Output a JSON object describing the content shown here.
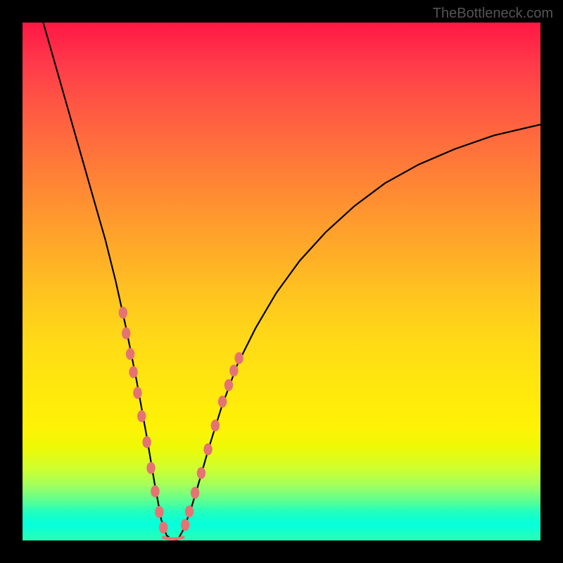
{
  "watermark_text": "TheBottleneck.com",
  "chart_data": {
    "type": "line",
    "title": "",
    "xlabel": "",
    "ylabel": "",
    "description": "V-shaped bottleneck curve over a rainbow gradient (red at top = high bottleneck, green at bottom = no bottleneck). The notch dips to zero around x≈0.29 indicating the optimal pairing.",
    "x_norm_range": [
      0,
      1
    ],
    "y_norm_range": [
      0,
      1
    ],
    "notch_x": 0.29,
    "curve_points_norm": [
      {
        "x": 0.04,
        "y": 1.0
      },
      {
        "x": 0.06,
        "y": 0.93
      },
      {
        "x": 0.08,
        "y": 0.86
      },
      {
        "x": 0.1,
        "y": 0.79
      },
      {
        "x": 0.12,
        "y": 0.72
      },
      {
        "x": 0.14,
        "y": 0.65
      },
      {
        "x": 0.16,
        "y": 0.58
      },
      {
        "x": 0.18,
        "y": 0.5
      },
      {
        "x": 0.2,
        "y": 0.41
      },
      {
        "x": 0.22,
        "y": 0.31
      },
      {
        "x": 0.24,
        "y": 0.2
      },
      {
        "x": 0.255,
        "y": 0.11
      },
      {
        "x": 0.268,
        "y": 0.04
      },
      {
        "x": 0.278,
        "y": 0.01
      },
      {
        "x": 0.29,
        "y": 0.0
      },
      {
        "x": 0.3,
        "y": 0.002
      },
      {
        "x": 0.31,
        "y": 0.02
      },
      {
        "x": 0.325,
        "y": 0.06
      },
      {
        "x": 0.34,
        "y": 0.11
      },
      {
        "x": 0.36,
        "y": 0.18
      },
      {
        "x": 0.385,
        "y": 0.26
      },
      {
        "x": 0.415,
        "y": 0.34
      },
      {
        "x": 0.45,
        "y": 0.41
      },
      {
        "x": 0.49,
        "y": 0.478
      },
      {
        "x": 0.535,
        "y": 0.54
      },
      {
        "x": 0.585,
        "y": 0.595
      },
      {
        "x": 0.64,
        "y": 0.645
      },
      {
        "x": 0.7,
        "y": 0.69
      },
      {
        "x": 0.765,
        "y": 0.726
      },
      {
        "x": 0.835,
        "y": 0.756
      },
      {
        "x": 0.91,
        "y": 0.782
      },
      {
        "x": 1.0,
        "y": 0.803
      }
    ],
    "salmon_markers_norm": [
      {
        "x": 0.194,
        "y": 0.44,
        "type": "dot"
      },
      {
        "x": 0.2,
        "y": 0.4,
        "type": "dot"
      },
      {
        "x": 0.208,
        "y": 0.36,
        "type": "dot"
      },
      {
        "x": 0.214,
        "y": 0.325,
        "type": "dot"
      },
      {
        "x": 0.222,
        "y": 0.285,
        "type": "dot"
      },
      {
        "x": 0.23,
        "y": 0.24,
        "type": "dot"
      },
      {
        "x": 0.24,
        "y": 0.19,
        "type": "dot"
      },
      {
        "x": 0.248,
        "y": 0.14,
        "type": "dot"
      },
      {
        "x": 0.256,
        "y": 0.095,
        "type": "dot"
      },
      {
        "x": 0.264,
        "y": 0.055,
        "type": "dot"
      },
      {
        "x": 0.272,
        "y": 0.025,
        "type": "dot"
      },
      {
        "x": 0.314,
        "y": 0.03,
        "type": "dot"
      },
      {
        "x": 0.322,
        "y": 0.056,
        "type": "dot"
      },
      {
        "x": 0.333,
        "y": 0.092,
        "type": "dot"
      },
      {
        "x": 0.345,
        "y": 0.13,
        "type": "dot"
      },
      {
        "x": 0.358,
        "y": 0.176,
        "type": "dot"
      },
      {
        "x": 0.372,
        "y": 0.222,
        "type": "dot"
      },
      {
        "x": 0.386,
        "y": 0.268,
        "type": "dot"
      },
      {
        "x": 0.398,
        "y": 0.3,
        "type": "dot"
      },
      {
        "x": 0.408,
        "y": 0.328,
        "type": "dot"
      },
      {
        "x": 0.418,
        "y": 0.352,
        "type": "dot"
      }
    ],
    "gradient_stops": [
      {
        "pos": 0.0,
        "color": "#ff1744"
      },
      {
        "pos": 0.5,
        "color": "#ffb126"
      },
      {
        "pos": 0.8,
        "color": "#fff206"
      },
      {
        "pos": 0.93,
        "color": "#4cff9e"
      },
      {
        "pos": 1.0,
        "color": "#28ffb6"
      }
    ]
  }
}
